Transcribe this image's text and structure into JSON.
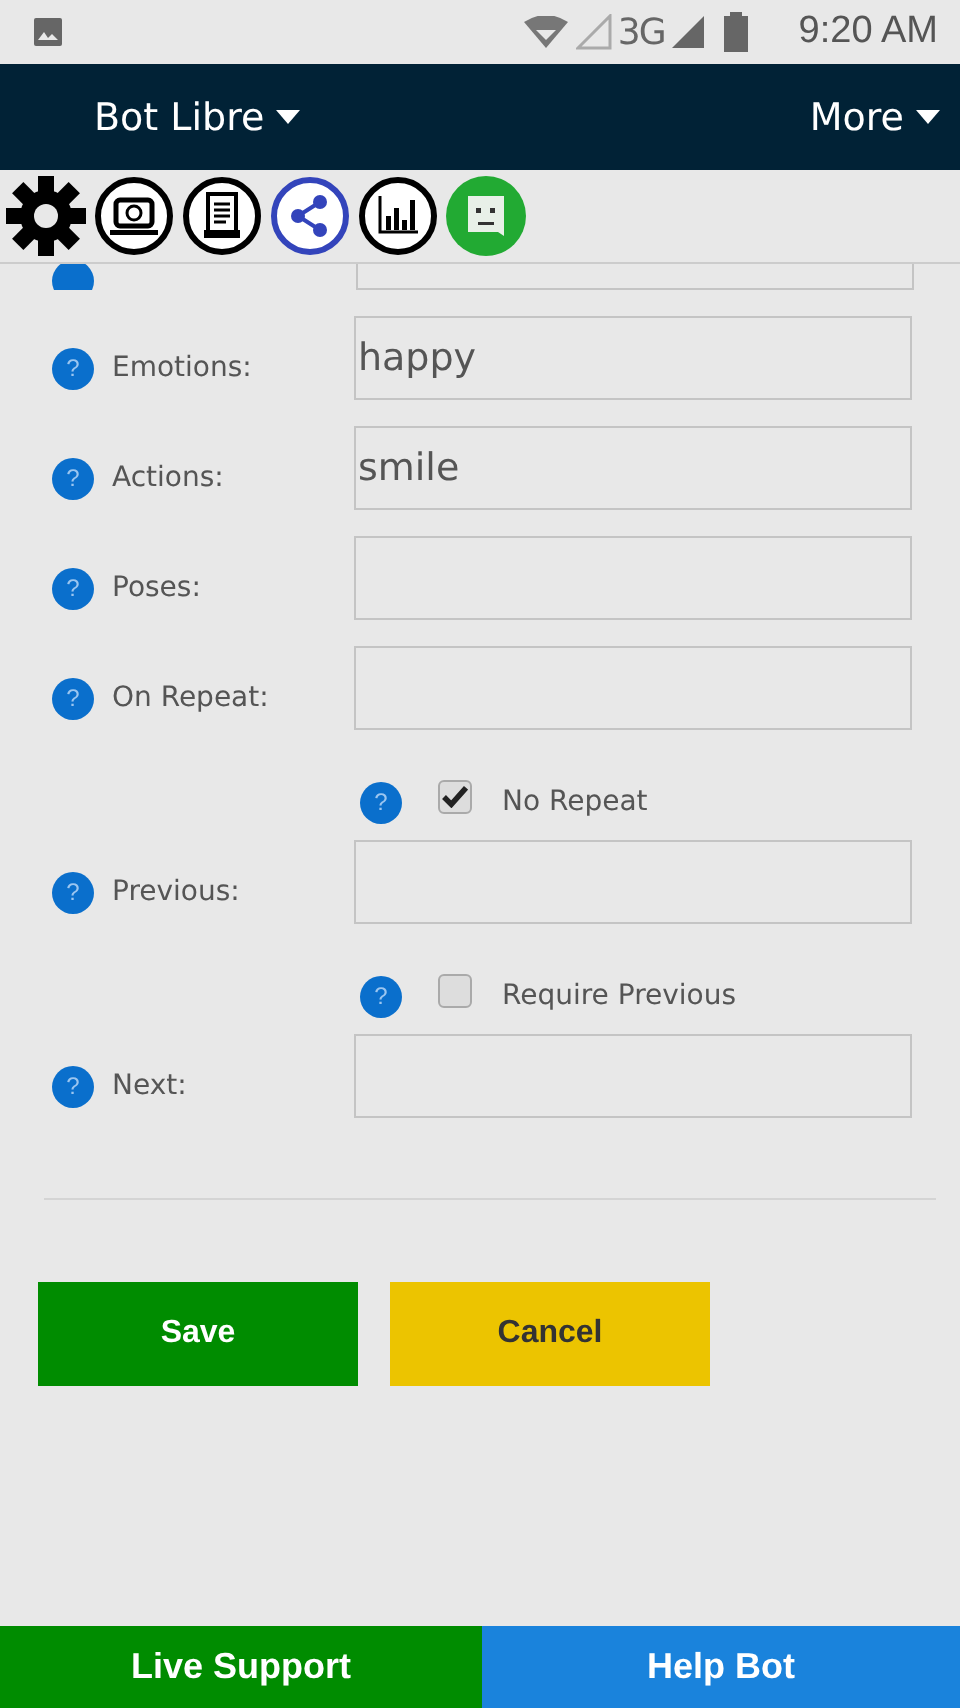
{
  "status_bar": {
    "time": "9:20 AM",
    "network": "3G"
  },
  "nav": {
    "title": "Bot Libre",
    "menu": "More"
  },
  "toolbar": [
    {
      "kind": "gear"
    },
    {
      "kind": "screen"
    },
    {
      "kind": "scroll"
    },
    {
      "kind": "share"
    },
    {
      "kind": "chart"
    },
    {
      "kind": "face"
    }
  ],
  "form": [
    {
      "kind": "field",
      "help": "?",
      "label": "Emotions:",
      "value": "happy"
    },
    {
      "kind": "field",
      "help": "?",
      "label": "Actions:",
      "value": "smile"
    },
    {
      "kind": "field",
      "help": "?",
      "label": "Poses:"
    },
    {
      "kind": "field",
      "help": "?",
      "label": "On Repeat:"
    },
    {
      "kind": "checkbox",
      "help": "?",
      "label": "No Repeat",
      "checked": true
    },
    {
      "kind": "field",
      "help": "?",
      "label": "Previous:"
    },
    {
      "kind": "checkbox",
      "help": "?",
      "label": "Require Previous",
      "checked": false
    },
    {
      "kind": "field",
      "help": "?",
      "label": "Next:"
    }
  ],
  "buttons": [
    {
      "label": "Save",
      "kind": "save"
    },
    {
      "label": "Cancel",
      "kind": "cancel"
    }
  ],
  "bottom_bar": [
    {
      "label": "Live Support",
      "kind": "support"
    },
    {
      "label": "Help Bot",
      "kind": "help"
    }
  ]
}
